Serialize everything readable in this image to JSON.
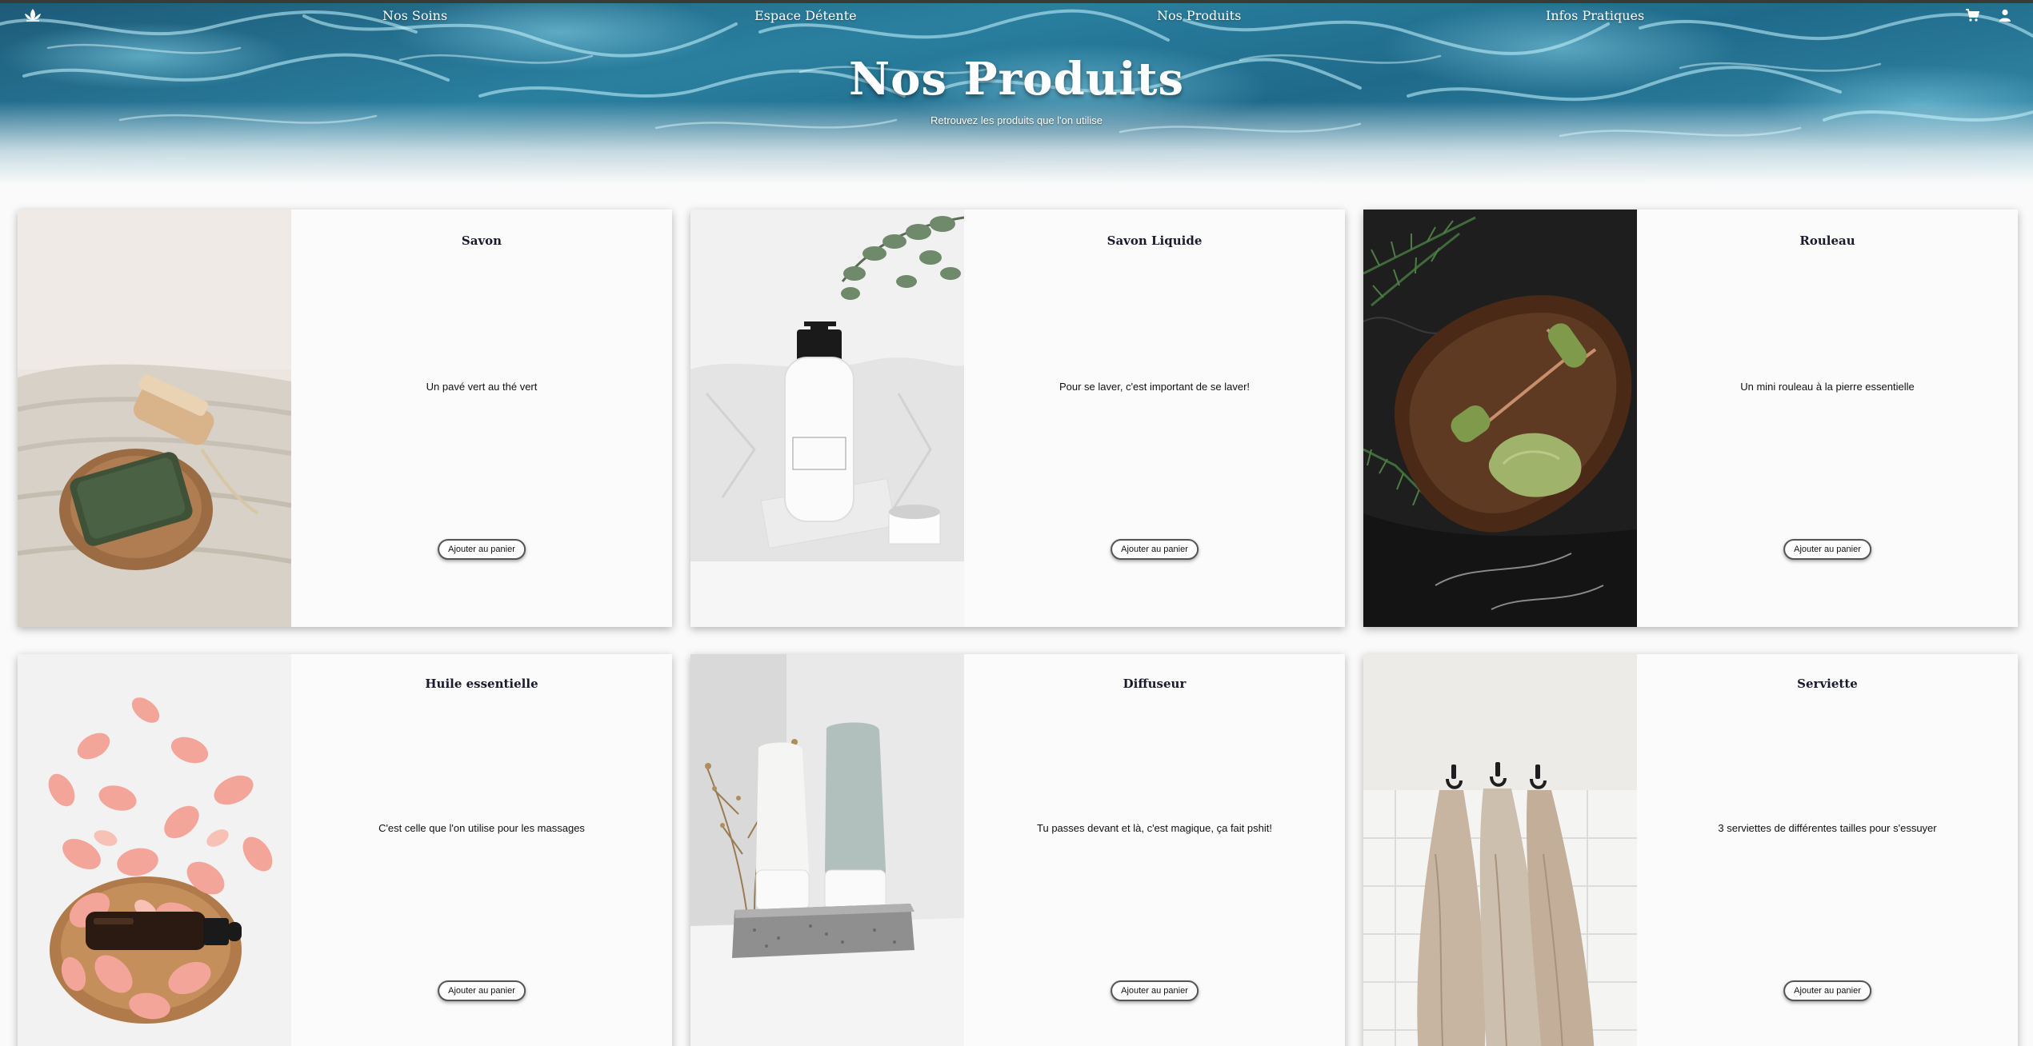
{
  "nav": {
    "logo_icon": "lotus-icon",
    "links": [
      "Nos Soins",
      "Espace Détente",
      "Nos Produits",
      "Infos Pratiques"
    ],
    "cart_icon": "cart-icon",
    "user_icon": "user-icon"
  },
  "hero": {
    "title": "Nos Produits",
    "subtitle": "Retrouvez les produits que l'on utilise"
  },
  "products": [
    {
      "name": "Savon",
      "description": "Un pavé vert au thé vert",
      "button": "Ajouter au panier",
      "image": "soap-on-towel"
    },
    {
      "name": "Savon Liquide",
      "description": "Pour se laver, c'est important de se laver!",
      "button": "Ajouter au panier",
      "image": "pump-bottle-with-eucalyptus"
    },
    {
      "name": "Rouleau",
      "description": "Un mini rouleau à la pierre essentielle",
      "button": "Ajouter au panier",
      "image": "jade-roller-on-wooden-tray"
    },
    {
      "name": "Huile essentielle",
      "description": "C'est celle que l'on utilise pour les massages",
      "button": "Ajouter au panier",
      "image": "oil-bottle-with-rose-petals"
    },
    {
      "name": "Diffuseur",
      "description": "Tu passes devant et là, c'est magique, ça fait pshit!",
      "button": "Ajouter au panier",
      "image": "diffuser-bottles-on-stone"
    },
    {
      "name": "Serviette",
      "description": "3 serviettes de différentes tailles pour s'essuyer",
      "button": "Ajouter au panier",
      "image": "towels-on-hooks"
    }
  ],
  "colors": {
    "water_dark": "#1d5a78",
    "water_light": "#3b92b1",
    "card_bg": "#fbfbfb",
    "title_text": "#1a1a2e"
  }
}
